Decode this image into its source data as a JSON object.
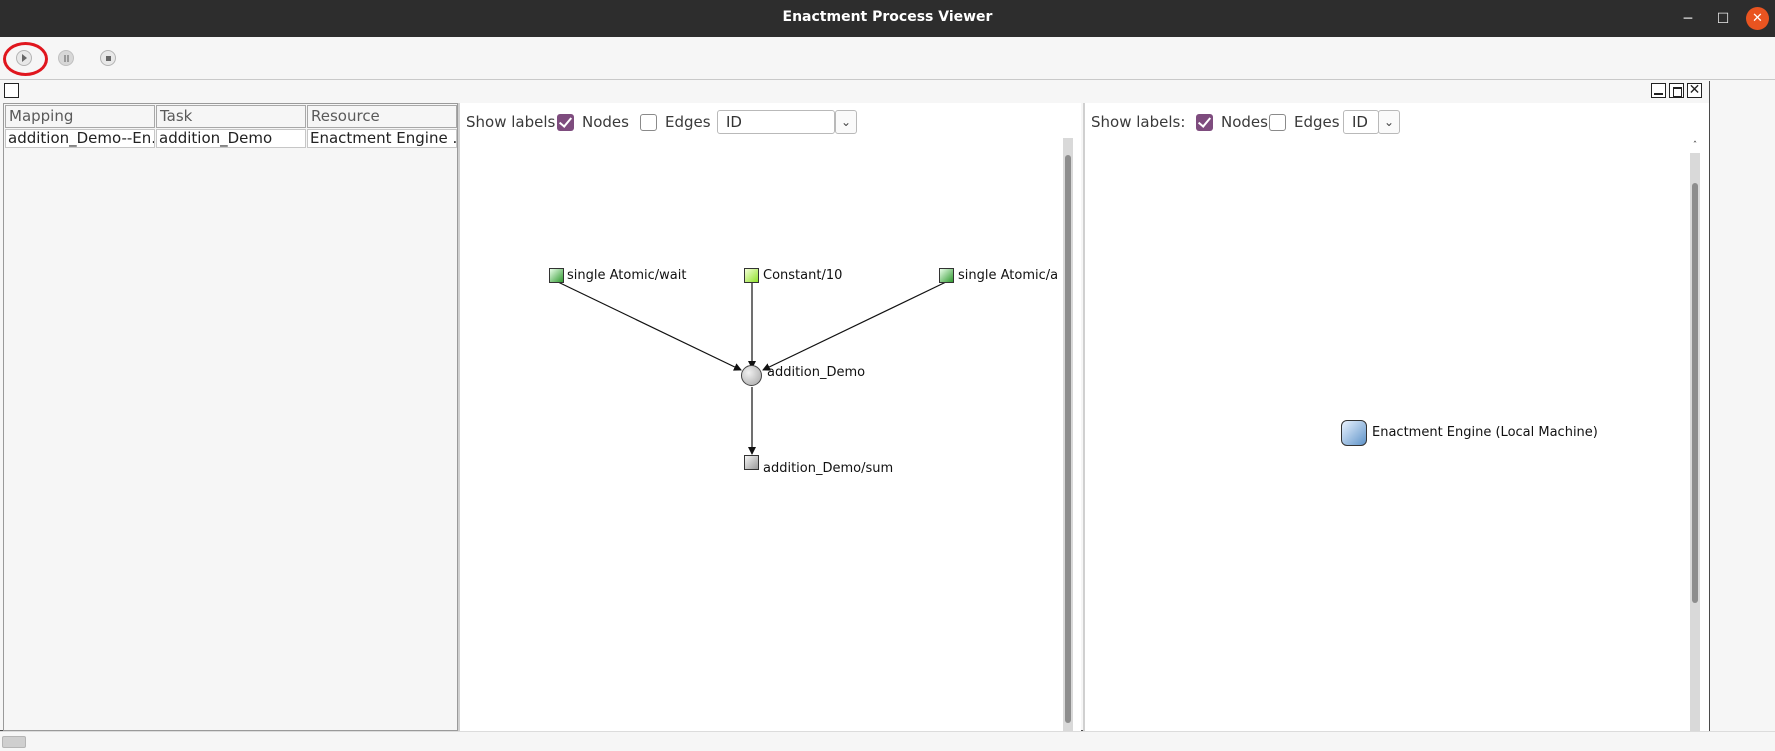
{
  "window": {
    "title": "Enactment Process Viewer",
    "controls": {
      "minimize": "─",
      "maximize": "☐",
      "close": "✕"
    }
  },
  "toolbar": {
    "buttons": [
      {
        "name": "play",
        "icon": "play-icon",
        "highlighted": true,
        "highlight_color": "#e0161e"
      },
      {
        "name": "pause",
        "icon": "pause-icon",
        "enabled": false
      },
      {
        "name": "stop",
        "icon": "stop-icon"
      }
    ]
  },
  "frame_controls": {
    "close": "✕"
  },
  "table": {
    "columns": [
      "Mapping",
      "Task",
      "Resource"
    ],
    "rows": [
      [
        "addition_Demo--En...",
        "addition_Demo",
        "Enactment Engine ..."
      ]
    ]
  },
  "process_graph": {
    "show_labels": "Show labels:",
    "nodes_label": "Nodes",
    "nodes_checked": true,
    "edges_label": "Edges",
    "edges_checked": false,
    "label_type": "ID",
    "nodes": [
      {
        "label": "single Atomic/wait",
        "kind": "input-data",
        "color": "#2f9a2f"
      },
      {
        "label": "Constant/10",
        "kind": "constant-data",
        "color": "#8fe02a"
      },
      {
        "label": "single Atomic/a",
        "kind": "input-data",
        "color": "#2f9a2f"
      },
      {
        "label": "addition_Demo",
        "kind": "task"
      },
      {
        "label": "addition_Demo/sum",
        "kind": "output-data",
        "color": "#9a9a9a"
      }
    ],
    "edges": [
      {
        "from": "single Atomic/wait",
        "to": "addition_Demo"
      },
      {
        "from": "Constant/10",
        "to": "addition_Demo"
      },
      {
        "from": "single Atomic/a",
        "to": "addition_Demo"
      },
      {
        "from": "addition_Demo",
        "to": "addition_Demo/sum"
      }
    ]
  },
  "resource_graph": {
    "show_labels": "Show labels:",
    "nodes_label": "Nodes",
    "nodes_checked": true,
    "edges_label": "Edges",
    "edges_checked": false,
    "label_type": "ID",
    "nodes": [
      {
        "label": "Enactment Engine (Local Machine)",
        "kind": "resource",
        "color": "#5e93c8"
      }
    ]
  },
  "colors": {
    "titlebar": "#2d2d2d",
    "close_button": "#e95420",
    "checkbox_checked": "#7e4c7e"
  }
}
